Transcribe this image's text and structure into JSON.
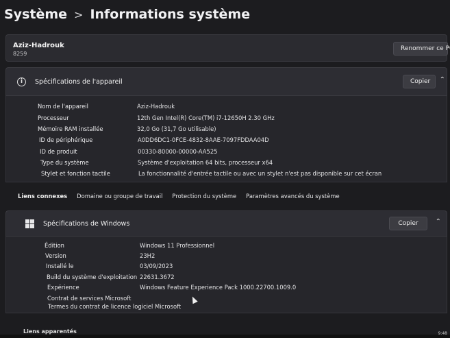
{
  "header": {
    "root": "Système",
    "current": "Informations système"
  },
  "pc": {
    "name": "Aziz-Hadrouk",
    "subtitle": "8259",
    "rename_label": "Renommer ce PC"
  },
  "device_specs": {
    "title": "Spécifications de l'appareil",
    "copy_label": "Copier",
    "rows": [
      {
        "key": "Nom de l'appareil",
        "value": "Aziz-Hadrouk"
      },
      {
        "key": "Processeur",
        "value": "12th Gen Intel(R) Core(TM) i7-12650H   2.30 GHz"
      },
      {
        "key": "Mémoire RAM installée",
        "value": "32,0 Go (31,7 Go utilisable)"
      },
      {
        "key": "ID de périphérique",
        "value": "A0DD6DC1-0FCE-4832-8AAE-7097FDDAA04D"
      },
      {
        "key": "ID de produit",
        "value": "00330-80000-00000-AA525"
      },
      {
        "key": "Type du système",
        "value": "Système d'exploitation 64 bits, processeur x64"
      },
      {
        "key": "Stylet et fonction tactile",
        "value": "La fonctionnalité d'entrée tactile ou avec un stylet n'est pas disponible sur cet écran"
      }
    ]
  },
  "related_links": {
    "label": "Liens connexes",
    "items": [
      "Domaine ou groupe de travail",
      "Protection du système",
      "Paramètres avancés du système"
    ]
  },
  "windows_specs": {
    "title": "Spécifications de Windows",
    "copy_label": "Copier",
    "rows": [
      {
        "key": "Édition",
        "value": "Windows 11 Professionnel"
      },
      {
        "key": "Version",
        "value": "23H2"
      },
      {
        "key": "Installé le",
        "value": "03/09/2023"
      },
      {
        "key": "Build du système d'exploitation",
        "value": "22631.3672"
      },
      {
        "key": "Expérience",
        "value": "Windows Feature Experience Pack 1000.22700.1009.0"
      }
    ],
    "links": [
      "Contrat de services Microsoft",
      "Termes du contrat de licence logiciel Microsoft"
    ]
  },
  "footer": {
    "related": "Liens apparentés",
    "clock": "9:48"
  }
}
